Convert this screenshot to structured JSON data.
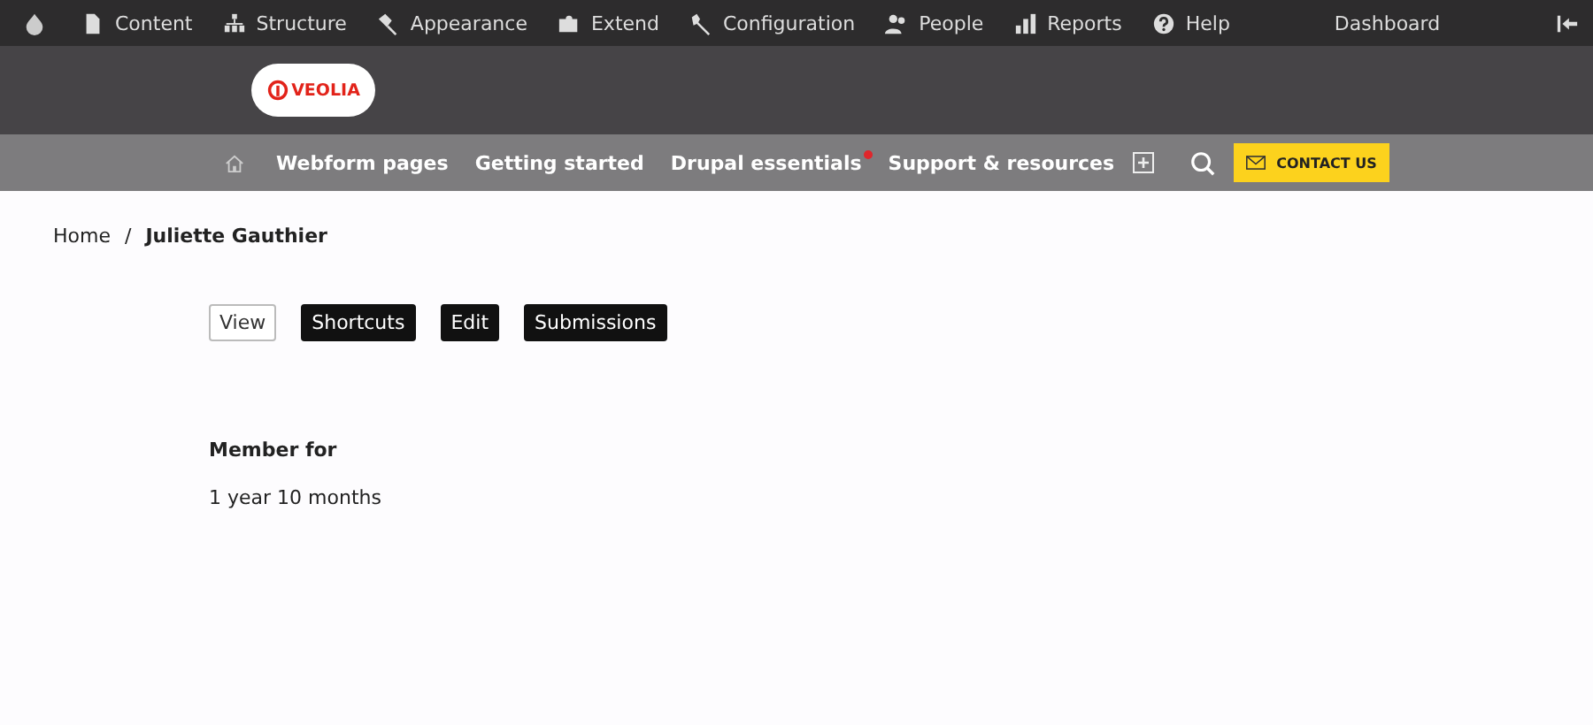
{
  "toolbar": {
    "items": [
      {
        "label": "Content"
      },
      {
        "label": "Structure"
      },
      {
        "label": "Appearance"
      },
      {
        "label": "Extend"
      },
      {
        "label": "Configuration"
      },
      {
        "label": "People"
      },
      {
        "label": "Reports"
      },
      {
        "label": "Help"
      }
    ],
    "dashboard": "Dashboard"
  },
  "logo": {
    "text": "VEOLIA"
  },
  "nav": {
    "items": [
      {
        "label": "Webform pages",
        "notification": false,
        "expandable": false
      },
      {
        "label": "Getting started",
        "notification": false,
        "expandable": false
      },
      {
        "label": "Drupal essentials",
        "notification": true,
        "expandable": false
      },
      {
        "label": "Support & resources",
        "notification": false,
        "expandable": true
      }
    ],
    "contact": "CONTACT US"
  },
  "breadcrumb": {
    "home": "Home",
    "separator": "/",
    "current": "Juliette Gauthier"
  },
  "tabs": [
    {
      "label": "View",
      "selected": true
    },
    {
      "label": "Shortcuts",
      "selected": false
    },
    {
      "label": "Edit",
      "selected": false
    },
    {
      "label": "Submissions",
      "selected": false
    }
  ],
  "field": {
    "label": "Member for",
    "value": "1 year 10 months"
  }
}
